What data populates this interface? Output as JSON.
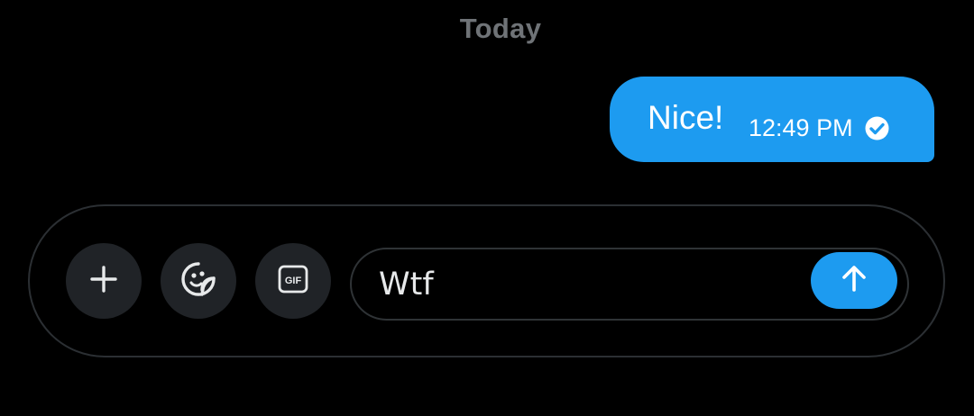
{
  "conversation": {
    "date_divider": "Today",
    "messages": [
      {
        "text": "Nice!",
        "time": "12:49 PM",
        "status_icon": "check-circle-icon",
        "direction": "outgoing"
      }
    ]
  },
  "composer": {
    "add_icon": "plus-icon",
    "sticker_icon": "sticker-smile-icon",
    "gif_icon": "gif-icon",
    "gif_label": "GIF",
    "input_value": "Wtf",
    "send_icon": "arrow-up-icon"
  },
  "colors": {
    "background": "#000000",
    "accent": "#1d9bf0",
    "button_bg": "#202327",
    "border": "#2f3336",
    "muted_text": "#6f7377",
    "text": "#e7e9ea"
  }
}
